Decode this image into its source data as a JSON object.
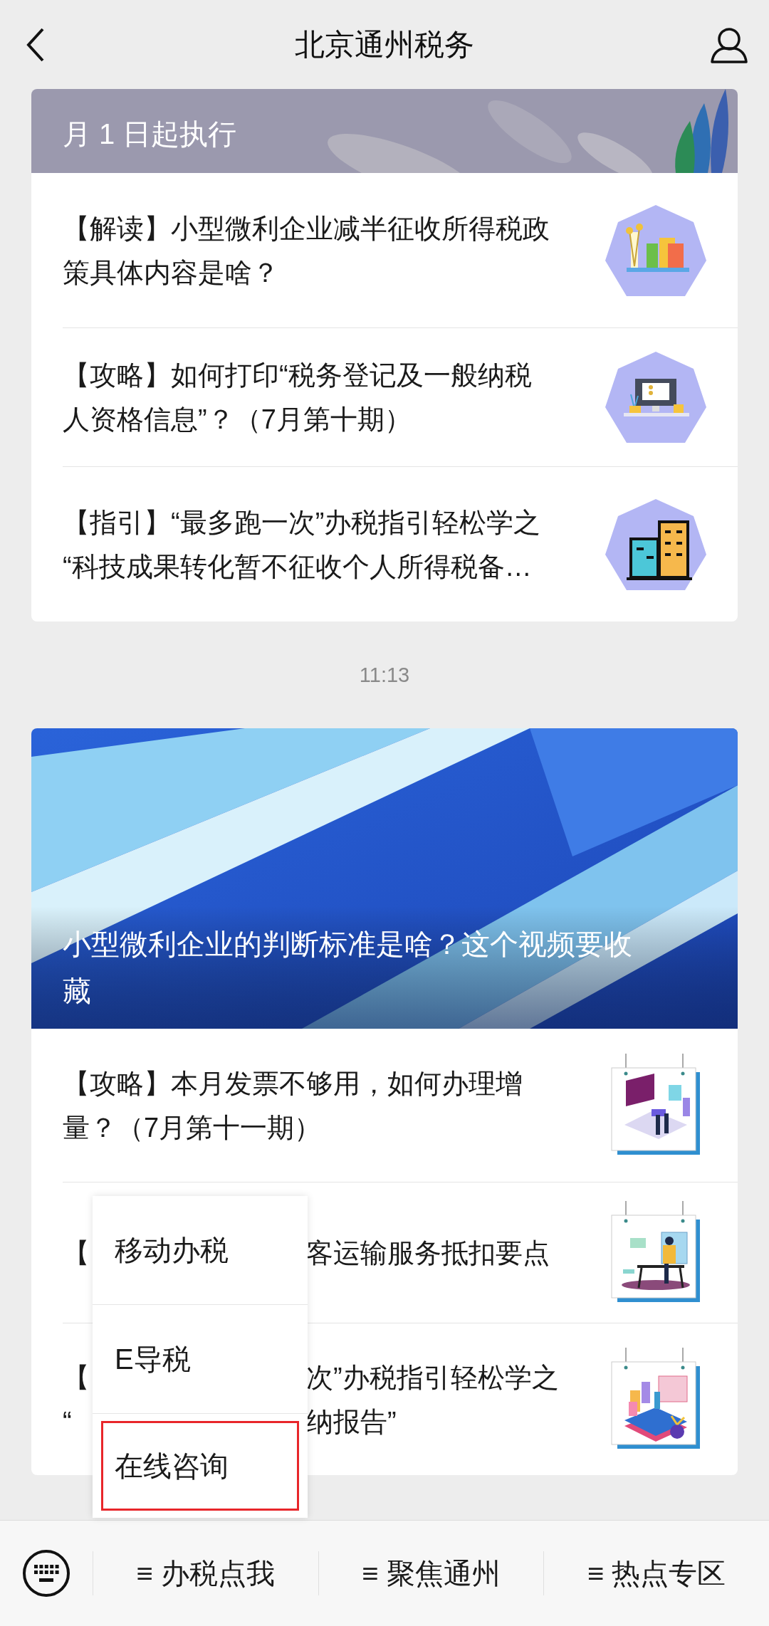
{
  "header": {
    "title": "北京通州税务"
  },
  "feed": [
    {
      "kind": "card",
      "banner_title": [
        "月 1 日起执行"
      ],
      "rows": [
        {
          "kind": "full",
          "lines": [
            "【解读】小型微利企业减半征收所得税政",
            "策具体内容是啥？"
          ]
        },
        {
          "kind": "full",
          "lines": [
            "【攻略】如何打印“税务登记及一般纳税",
            "人资格信息”？（7月第十期）"
          ]
        },
        {
          "kind": "full",
          "lines": [
            "【指引】“最多跑一次”办税指引轻松学之",
            "“科技成果转化暂不征收个人所得税备…"
          ]
        }
      ]
    },
    {
      "kind": "time",
      "text": "11:13"
    },
    {
      "kind": "card",
      "banner_title": [
        "小型微利企业的判断标准是啥？这个视频要收",
        "藏"
      ],
      "rows": [
        {
          "kind": "full",
          "lines": [
            "【攻略】本月发票不够用，如何办理增",
            "量？（7月第十一期）"
          ]
        },
        {
          "kind": "partial",
          "lines": [
            {
              "left": "【",
              "right": "客运输服务抵扣要点"
            }
          ]
        },
        {
          "kind": "partial",
          "lines": [
            {
              "left": "【",
              "right": "次”办税指引轻松学之"
            },
            {
              "left": "“",
              "right": "纳报告”"
            }
          ]
        }
      ]
    }
  ],
  "menu_bar": {
    "tabs": [
      {
        "label": "≡ 办税点我",
        "submenu": [
          {
            "label": "移动办税",
            "highlighted": false
          },
          {
            "label": "E导税",
            "highlighted": false
          },
          {
            "label": "在线咨询",
            "highlighted": true
          }
        ]
      },
      {
        "label": "≡ 聚焦通州"
      },
      {
        "label": "≡ 热点专区"
      }
    ]
  }
}
